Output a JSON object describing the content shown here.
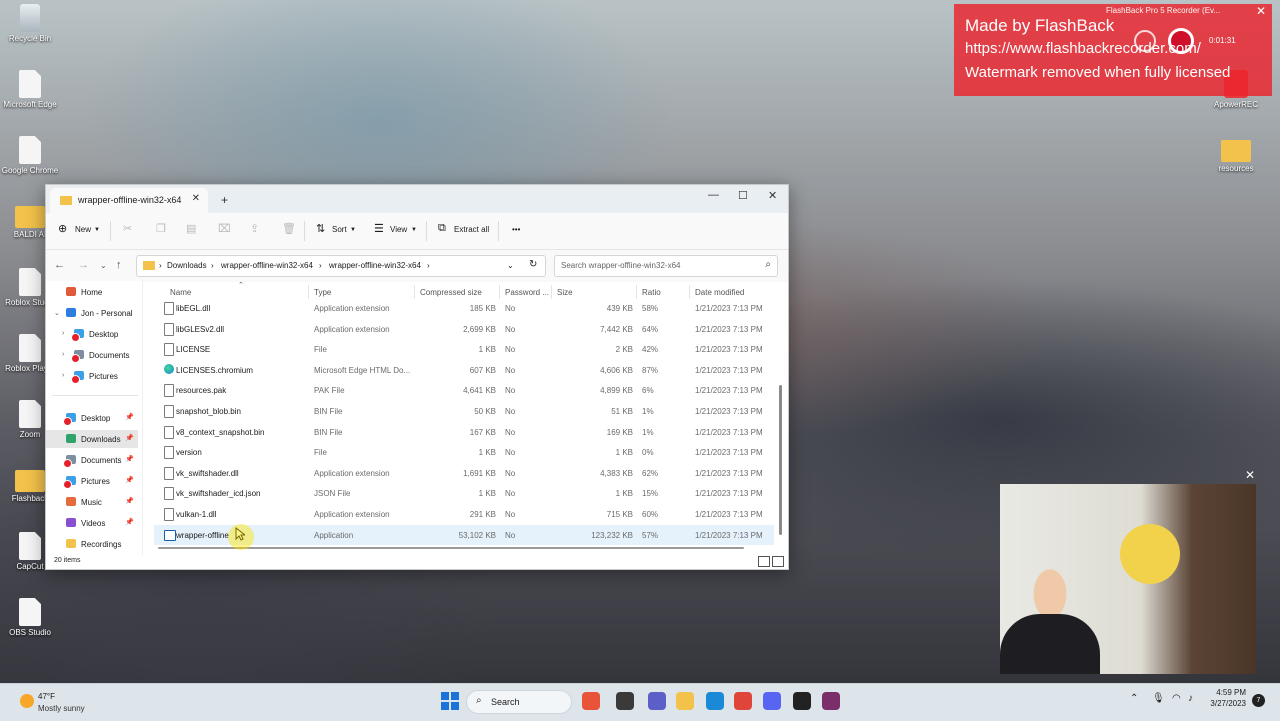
{
  "desktop": {
    "icons_left": [
      {
        "label": "Recycle Bin",
        "kind": "bin"
      },
      {
        "label": "Microsoft Edge",
        "kind": "file"
      },
      {
        "label": "Google Chrome",
        "kind": "file"
      },
      {
        "label": "BALDI AI",
        "kind": "folder"
      },
      {
        "label": "Roblox Studio",
        "kind": "file"
      },
      {
        "label": "Roblox Player",
        "kind": "file"
      },
      {
        "label": "Zoom",
        "kind": "file"
      },
      {
        "label": "Flashback",
        "kind": "folder"
      },
      {
        "label": "CapCut",
        "kind": "file"
      },
      {
        "label": "OBS Studio",
        "kind": "file"
      }
    ],
    "icons_right": [
      {
        "label": "ApowerREC",
        "kind": "red"
      },
      {
        "label": "resources",
        "kind": "folder"
      }
    ]
  },
  "watermark": {
    "line1": "Made by FlashBack",
    "line2": "https://www.flashbackrecorder.com/",
    "line3": "Watermark removed when fully licensed",
    "recorder_title": "FlashBack Pro 5 Recorder (Ev...",
    "timer": "0:01:31",
    "close": "✕"
  },
  "webcam": {
    "close": "✕"
  },
  "explorer": {
    "tab_title": "wrapper-offline-win32-x64",
    "tab_close": "✕",
    "new_tab": "+",
    "controls": {
      "minimize": "—",
      "maximize": "☐",
      "close": "✕"
    },
    "toolbar": {
      "new": "New",
      "sort": "Sort",
      "view": "View",
      "extract_all": "Extract all",
      "more": "•••"
    },
    "breadcrumb": [
      "Downloads",
      "wrapper-offline-win32-x64",
      "wrapper-offline-win32-x64"
    ],
    "search_placeholder": "Search wrapper-offline-win32-x64",
    "sidebar": [
      {
        "label": "Home",
        "color": "#e05a3a"
      },
      {
        "label": "Jon - Personal",
        "color": "#2b7de0"
      },
      {
        "label": "Desktop",
        "color": "#3aa0e8"
      },
      {
        "label": "Documents",
        "color": "#7d8ea0"
      },
      {
        "label": "Pictures",
        "color": "#3aa0e8"
      },
      {
        "label": "Desktop",
        "color": "#3aa0e8"
      },
      {
        "label": "Downloads",
        "color": "#2fa36b"
      },
      {
        "label": "Documents",
        "color": "#7d8ea0"
      },
      {
        "label": "Pictures",
        "color": "#3aa0e8"
      },
      {
        "label": "Music",
        "color": "#e56b3a"
      },
      {
        "label": "Videos",
        "color": "#8a4fd0"
      },
      {
        "label": "Recordings",
        "color": "#f3c24a"
      }
    ],
    "columns": [
      "Name",
      "Type",
      "Compressed size",
      "Password ...",
      "Size",
      "Ratio",
      "Date modified"
    ],
    "files": [
      {
        "name": "libEGL.dll",
        "type": "Application extension",
        "csize": "185 KB",
        "pw": "No",
        "size": "439 KB",
        "ratio": "58%",
        "date": "1/21/2023 7:13 PM",
        "icon": "file"
      },
      {
        "name": "libGLESv2.dll",
        "type": "Application extension",
        "csize": "2,699 KB",
        "pw": "No",
        "size": "7,442 KB",
        "ratio": "64%",
        "date": "1/21/2023 7:13 PM",
        "icon": "file"
      },
      {
        "name": "LICENSE",
        "type": "File",
        "csize": "1 KB",
        "pw": "No",
        "size": "2 KB",
        "ratio": "42%",
        "date": "1/21/2023 7:13 PM",
        "icon": "file"
      },
      {
        "name": "LICENSES.chromium",
        "type": "Microsoft Edge HTML Do...",
        "csize": "607 KB",
        "pw": "No",
        "size": "4,606 KB",
        "ratio": "87%",
        "date": "1/21/2023 7:13 PM",
        "icon": "edge"
      },
      {
        "name": "resources.pak",
        "type": "PAK File",
        "csize": "4,641 KB",
        "pw": "No",
        "size": "4,899 KB",
        "ratio": "6%",
        "date": "1/21/2023 7:13 PM",
        "icon": "file"
      },
      {
        "name": "snapshot_blob.bin",
        "type": "BIN File",
        "csize": "50 KB",
        "pw": "No",
        "size": "51 KB",
        "ratio": "1%",
        "date": "1/21/2023 7:13 PM",
        "icon": "file"
      },
      {
        "name": "v8_context_snapshot.bin",
        "type": "BIN File",
        "csize": "167 KB",
        "pw": "No",
        "size": "169 KB",
        "ratio": "1%",
        "date": "1/21/2023 7:13 PM",
        "icon": "file"
      },
      {
        "name": "version",
        "type": "File",
        "csize": "1 KB",
        "pw": "No",
        "size": "1 KB",
        "ratio": "0%",
        "date": "1/21/2023 7:13 PM",
        "icon": "file"
      },
      {
        "name": "vk_swiftshader.dll",
        "type": "Application extension",
        "csize": "1,691 KB",
        "pw": "No",
        "size": "4,383 KB",
        "ratio": "62%",
        "date": "1/21/2023 7:13 PM",
        "icon": "file"
      },
      {
        "name": "vk_swiftshader_icd.json",
        "type": "JSON File",
        "csize": "1 KB",
        "pw": "No",
        "size": "1 KB",
        "ratio": "15%",
        "date": "1/21/2023 7:13 PM",
        "icon": "file"
      },
      {
        "name": "vulkan-1.dll",
        "type": "Application extension",
        "csize": "291 KB",
        "pw": "No",
        "size": "715 KB",
        "ratio": "60%",
        "date": "1/21/2023 7:13 PM",
        "icon": "file"
      },
      {
        "name": "wrapper-offline",
        "type": "Application",
        "csize": "53,102 KB",
        "pw": "No",
        "size": "123,232 KB",
        "ratio": "57%",
        "date": "1/21/2023 7:13 PM",
        "icon": "app",
        "selected": true
      }
    ],
    "status": "20 items"
  },
  "taskbar": {
    "weather_temp": "47°F",
    "weather_desc": "Mostly sunny",
    "search_placeholder": "Search",
    "time": "4:59 PM",
    "date": "3/27/2023",
    "notifications": "7",
    "apps": [
      {
        "name": "widgets-app",
        "color": "#e8533a"
      },
      {
        "name": "task-view-app",
        "color": "#3a3a3a"
      },
      {
        "name": "teams-app",
        "color": "#5b5fc7"
      },
      {
        "name": "file-explorer-app",
        "color": "#f3c24a"
      },
      {
        "name": "edge-app",
        "color": "#1b8ad6"
      },
      {
        "name": "chrome-app",
        "color": "#e0453a"
      },
      {
        "name": "discord-app",
        "color": "#5865f2"
      },
      {
        "name": "github-app",
        "color": "#222222"
      },
      {
        "name": "slack-app",
        "color": "#7a2f6a"
      }
    ]
  }
}
